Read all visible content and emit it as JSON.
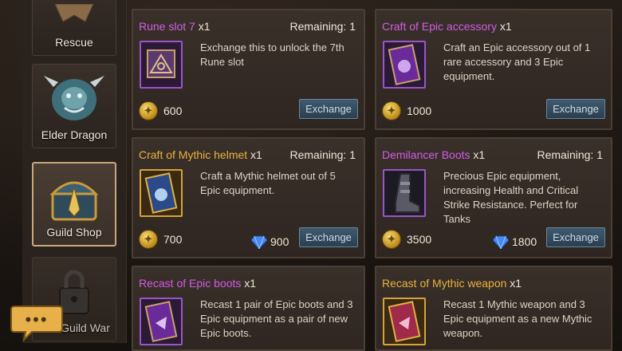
{
  "sidebar": {
    "items": [
      {
        "label": "Rescue"
      },
      {
        "label": "Elder Dragon"
      },
      {
        "label": "Guild Shop"
      },
      {
        "label": "Guild War"
      }
    ]
  },
  "cards": [
    {
      "title": "Rune slot 7",
      "qty": "x1",
      "remaining": "Remaining: 1",
      "desc": "Exchange this to unlock the 7th Rune slot",
      "cost": "600",
      "button": "Exchange",
      "icon": "rune-slot-icon"
    },
    {
      "title": "Craft of Epic accessory",
      "qty": "x1",
      "desc": "Craft an Epic accessory out of 1 rare accessory and 3 Epic equipment.",
      "cost": "1000",
      "button": "Exchange",
      "icon": "epic-scroll-icon"
    },
    {
      "title": "Craft of Mythic helmet",
      "qty": "x1",
      "remaining": "Remaining: 1",
      "desc": "Craft a Mythic helmet out of 5 Epic equipment.",
      "cost": "700",
      "gems": "900",
      "button": "Exchange",
      "icon": "mythic-scroll-icon"
    },
    {
      "title": "Demilancer Boots",
      "qty": "x1",
      "remaining": "Remaining: 1",
      "desc": "Precious Epic equipment, increasing Health and Critical Strike Resistance. Perfect for Tanks",
      "cost": "3500",
      "gems": "1800",
      "button": "Exchange",
      "icon": "boots-icon"
    },
    {
      "title": "Recast of Epic boots",
      "qty": "x1",
      "desc": "Recast 1 pair of Epic boots and 3 Epic equipment as a pair of new Epic boots.",
      "icon": "epic-recast-scroll-icon"
    },
    {
      "title": "Recast of Mythic weapon",
      "qty": "x1",
      "desc": "Recast 1 Mythic weapon and 3 Epic equipment as a new Mythic weapon.",
      "icon": "mythic-recast-scroll-icon"
    }
  ],
  "chat": {
    "icon": "chat-bubble-icon",
    "text": "•••"
  },
  "colors": {
    "epic": "#d25ce6",
    "mythic": "#e9b23e",
    "button": "#3f5a6e"
  }
}
